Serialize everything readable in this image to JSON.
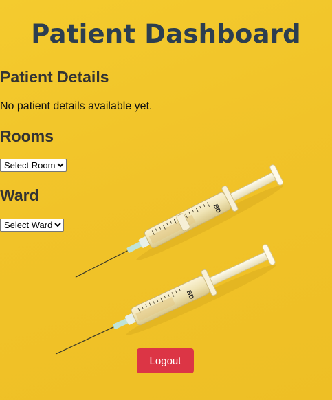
{
  "header": {
    "title": "Patient Dashboard"
  },
  "patient_details": {
    "heading": "Patient Details",
    "empty_text": "No patient details available yet."
  },
  "rooms": {
    "heading": "Rooms",
    "selected": "Select Room"
  },
  "ward": {
    "heading": "Ward",
    "selected": "Select Ward"
  },
  "actions": {
    "logout_label": "Logout"
  },
  "background": {
    "image_subject": "two syringes on yellow background",
    "syringe_brand_text": "BD"
  },
  "colors": {
    "background": "#f2c62a",
    "title": "#2c3e50",
    "logout": "#dc3545"
  }
}
